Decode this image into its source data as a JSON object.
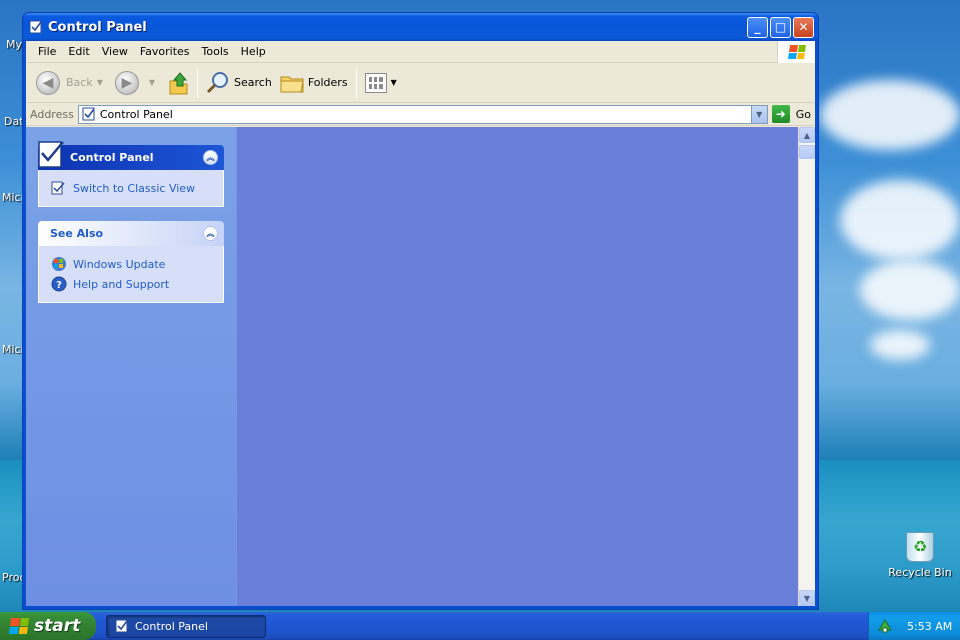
{
  "desktop": {
    "icons": [
      {
        "label": "My"
      },
      {
        "label": "Dat"
      },
      {
        "label": "Micr"
      },
      {
        "label": "Micr"
      },
      {
        "label": "Proc"
      }
    ],
    "recycle_bin": {
      "label": "Recycle Bin"
    }
  },
  "window": {
    "title": "Control Panel",
    "menu": [
      "File",
      "Edit",
      "View",
      "Favorites",
      "Tools",
      "Help"
    ],
    "toolbar": {
      "back_label": "Back",
      "search_label": "Search",
      "folders_label": "Folders"
    },
    "address": {
      "label": "Address",
      "value": "Control Panel",
      "go_label": "Go"
    },
    "taskpane": {
      "control_panel_box": {
        "title": "Control Panel",
        "links": [
          {
            "label": "Switch to Classic View",
            "icon": "switch-view-icon"
          }
        ]
      },
      "see_also_box": {
        "title": "See Also",
        "links": [
          {
            "label": "Windows Update",
            "icon": "windows-update-icon"
          },
          {
            "label": "Help and Support",
            "icon": "help-icon"
          }
        ]
      }
    }
  },
  "taskbar": {
    "start_label": "start",
    "task_label": "Control Panel",
    "clock": "5:53 AM"
  },
  "colors": {
    "taskpane_bg": "#7ba2e7",
    "mainview_bg": "#6a7fd8",
    "titlebar": "#0856d8",
    "start_green": "#388e38"
  }
}
